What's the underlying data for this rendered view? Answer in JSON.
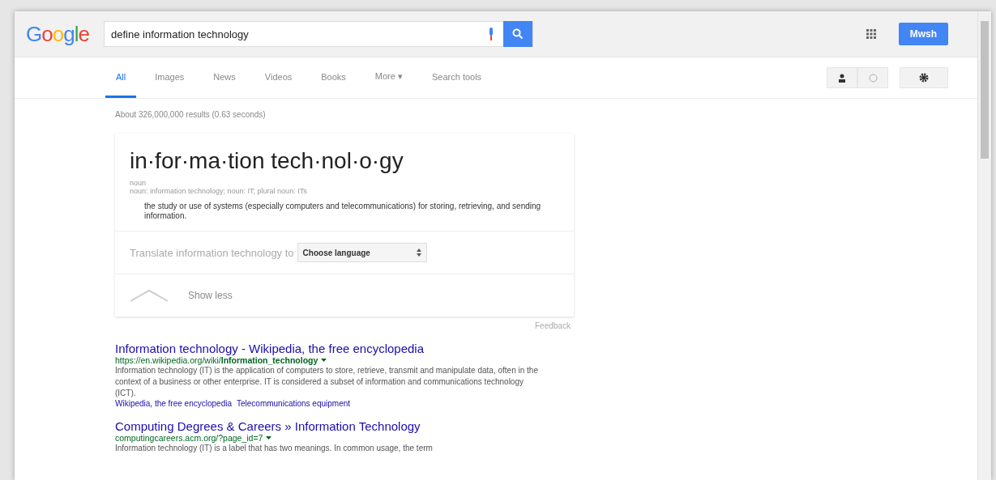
{
  "header": {
    "logo": "Google",
    "query": "define information technology",
    "sign_in": "Mwsh"
  },
  "tabs": [
    {
      "label": "All",
      "selected": true
    },
    {
      "label": "Images",
      "selected": false
    },
    {
      "label": "News",
      "selected": false
    },
    {
      "label": "Videos",
      "selected": false
    },
    {
      "label": "Books",
      "selected": false
    },
    {
      "label": "More ▾",
      "selected": false
    },
    {
      "label": "Search tools",
      "selected": false
    }
  ],
  "result_stats": "About 326,000,000 results (0.63 seconds)",
  "definition": {
    "word": "in·for·ma·tion tech·nol·o·gy",
    "part_of_speech": "noun",
    "forms": "noun: information technology; noun: IT; plural noun: ITs",
    "meaning": "the study or use of systems (especially computers and telecommunications) for storing, retrieving, and sending information.",
    "translate_label": "Translate information technology to",
    "language_select": "Choose language",
    "toggle": "Show less",
    "feedback": "Feedback"
  },
  "results": [
    {
      "title": "Information technology - Wikipedia, the free encyclopedia",
      "url": "https://en.wikipedia.org/wiki/**Information_technology**",
      "snippet": "Information technology (IT) is the application of computers to store, retrieve, transmit and manipulate data, often in the context of a business or other enterprise. IT is considered a subset of information and communications technology (ICT).",
      "sitelinks": [
        "Wikipedia, the free encyclopedia",
        "Telecommunications equipment"
      ]
    },
    {
      "title": "Computing Degrees & Careers » Information Technology",
      "url": "computingcareers.acm.org/?page_id=7",
      "snippet": "Information technology (IT) is a label that has two meanings. In common usage, the term"
    }
  ]
}
